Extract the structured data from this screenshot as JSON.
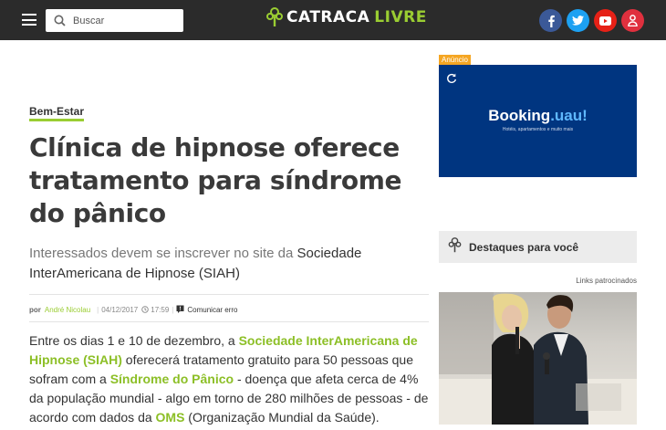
{
  "header": {
    "search_placeholder": "Buscar",
    "logo_part1": "CATRACA",
    "logo_part2": "LIVRE",
    "social": [
      "facebook-icon",
      "twitter-icon",
      "youtube-icon",
      "user-icon"
    ]
  },
  "article": {
    "category": "Bem-Estar",
    "title": "Clínica de hipnose oferece tratamento para síndrome do pânico",
    "subtitle_light": "Interessados devem se inscrever no site da ",
    "subtitle_dark": "Sociedade InterAmericana de Hipnose (SIAH)",
    "meta": {
      "by": "por",
      "author": "André Nicolau",
      "date": "04/12/2017",
      "time": "17:59",
      "report": "Comunicar erro"
    },
    "body": {
      "t1": "Entre os dias 1 e 10 de dezembro, a ",
      "l1": "Sociedade InterAmericana de Hipnose (SIAH)",
      "t2": " oferecerá tratamento gratuito para 50 pessoas que sofram com a ",
      "l2": "Síndrome do Pânico",
      "t3": " - doença que afeta cerca de 4% da população mundial - algo em torno de 280 milhões de pessoas - de acordo com dados da ",
      "l3": "OMS",
      "t4": " (Organização Mundial da Saúde)."
    }
  },
  "sidebar": {
    "ad_label": "Anúncio",
    "ad_brand_main": "Booking",
    "ad_brand_accent": ".uau!",
    "ad_tagline": "Hotéis, apartamentos e muito mais",
    "destaques": "Destaques para você",
    "links_patrocinados": "Links patrocinados"
  },
  "colors": {
    "accent": "#9acd32",
    "header_bg": "#2b2b2b",
    "ad_bg": "#003580"
  }
}
